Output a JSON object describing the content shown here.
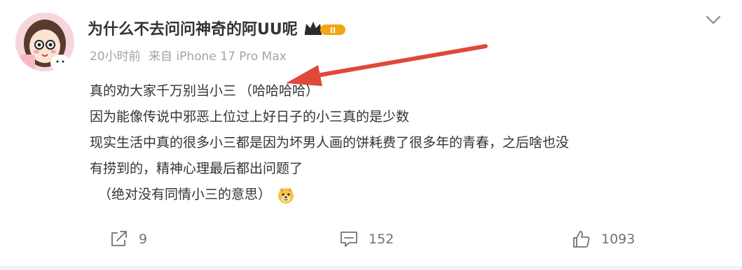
{
  "post": {
    "username": "为什么不去问问神奇的阿UU呢",
    "vip_badge_label": "II",
    "time": "20小时前",
    "source": "来自 iPhone 17 Pro Max",
    "content": {
      "line1_main": "真的劝大家千万别当小三",
      "line1_paren": "（哈哈哈哈）",
      "line2": "因为能像传说中邪恶上位过上好日子的小三真的是少数",
      "line3": "现实生活中真的很多小三都是因为坏男人画的饼耗费了很多年的青春，之后啥也没",
      "line4": "有捞到的，精神心理最后都出问题了",
      "line5": "（绝对没有同情小三的意思）"
    },
    "emoji_icon": "doge-emoji",
    "actions": {
      "share_count": "9",
      "comment_count": "152",
      "like_count": "1093"
    }
  },
  "colors": {
    "text": "#333333",
    "meta": "#a4a4a4",
    "action": "#737373",
    "annotation_arrow": "#e0483a",
    "vip_gold": "#f2a516"
  },
  "icons": [
    "avatar",
    "crown-icon",
    "chevron-down-icon",
    "share-icon",
    "comment-icon",
    "like-icon",
    "doge-emoji",
    "annotation-arrow"
  ]
}
